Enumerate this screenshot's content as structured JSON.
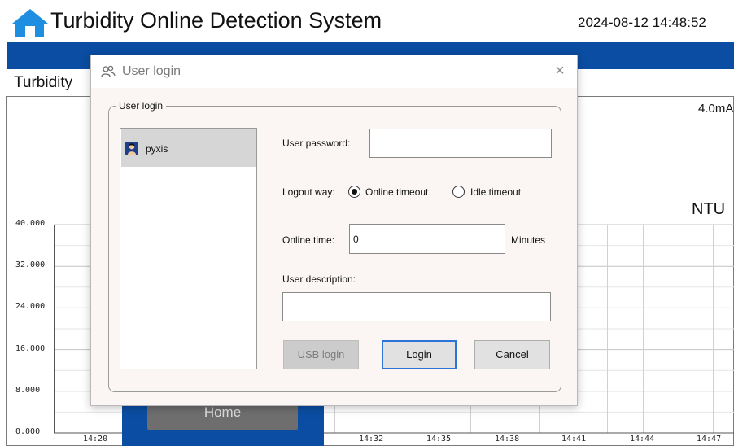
{
  "header": {
    "title": "Turbidity Online Detection System",
    "datetime": "2024-08-12 14:48:52",
    "home_icon": "home-icon"
  },
  "panel": {
    "title": "Turbidity",
    "ma_reading": "4.0mA",
    "unit": "NTU"
  },
  "chart_data": {
    "type": "line",
    "y_ticks": [
      "40.000",
      "32.000",
      "24.000",
      "16.000",
      "8.000",
      "0.000"
    ],
    "x_ticks": [
      "14:20",
      "14:32",
      "14:35",
      "14:38",
      "14:41",
      "14:44",
      "14:47"
    ],
    "ylim": [
      0,
      40
    ],
    "grid": true,
    "series": []
  },
  "home_button": {
    "label": "Home"
  },
  "dialog": {
    "title": "User login",
    "title_icon": "users-icon",
    "close_icon": "close-icon",
    "close_glyph": "×",
    "group_title": "User login",
    "users": [
      {
        "name": "pyxis",
        "icon": "user-avatar-icon"
      }
    ],
    "password_label": "User password:",
    "password_value": "",
    "logout_way_label": "Logout way:",
    "logout_options": [
      {
        "label": "Online timeout",
        "checked": true
      },
      {
        "label": "Idle timeout",
        "checked": false
      }
    ],
    "online_time_label": "Online time:",
    "online_time_value": "0",
    "online_time_unit": "Minutes",
    "description_label": "User description:",
    "description_value": "",
    "usb_login_label": "USB login",
    "login_label": "Login",
    "cancel_label": "Cancel"
  },
  "colors": {
    "brand_blue": "#0b4da2",
    "home_icon": "#1e8ee0",
    "login_focus": "#2c74d8"
  }
}
